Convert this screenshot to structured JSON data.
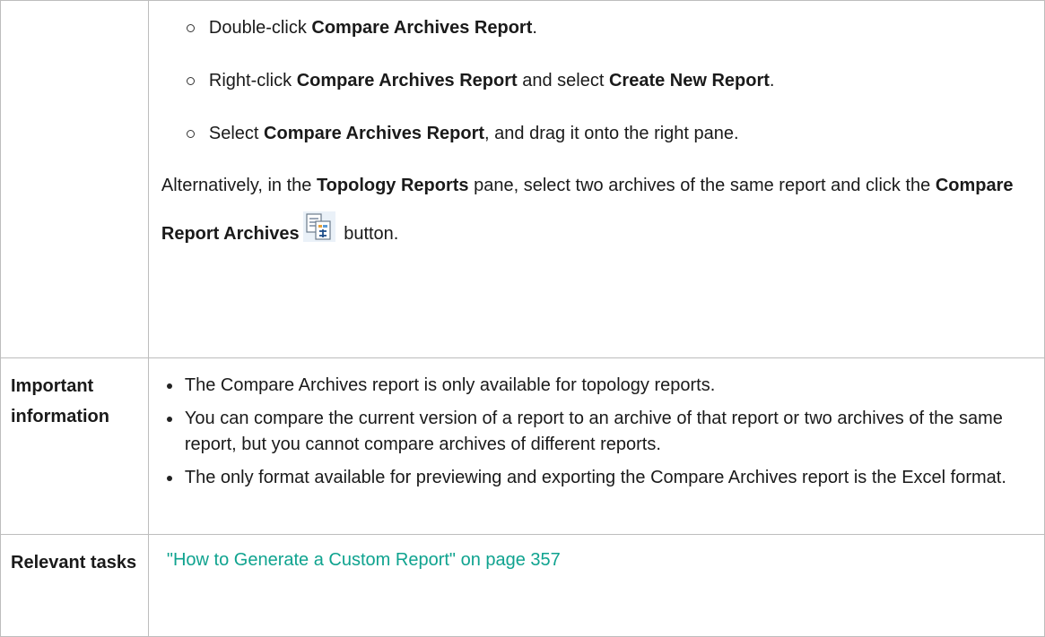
{
  "intro_items": [
    {
      "pre": "Double-click ",
      "b1": "Compare Archives Report",
      "mid": ".",
      "b2": "",
      "post": ""
    },
    {
      "pre": "Right-click ",
      "b1": "Compare Archives Report",
      "mid": " and select ",
      "b2": "Create New Report",
      "post": "."
    },
    {
      "pre": "Select ",
      "b1": "Compare Archives Report",
      "mid": ", and drag it onto the right pane.",
      "b2": "",
      "post": ""
    }
  ],
  "alt": {
    "t1": "Alternatively, in the ",
    "b1": "Topology Reports",
    "t2": " pane, select two archives of the same report and click the ",
    "b2": "Compare Report Archives",
    "t3": " button."
  },
  "important": {
    "label": "Important information",
    "items": [
      "The Compare Archives report is only available for topology reports.",
      "You can compare the current version of a report to an archive of that report or two archives of the same report, but you cannot compare archives of different reports.",
      "The only format available for previewing and exporting the Compare Archives report is the Excel format."
    ]
  },
  "relevant": {
    "label": "Relevant tasks",
    "link": "\"How to Generate a Custom Report\" on page 357"
  },
  "icons": {
    "compare": "compare-report-archives-icon"
  },
  "colors": {
    "link": "#0fa38f",
    "border": "#bdbdbd"
  }
}
